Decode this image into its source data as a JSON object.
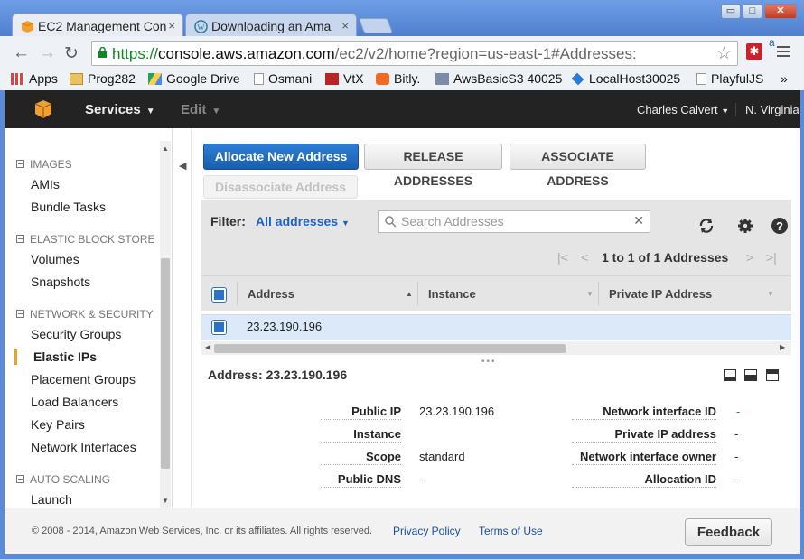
{
  "browser": {
    "tabs": [
      {
        "title": "EC2 Management Con",
        "close": "×"
      },
      {
        "title": "Downloading an Ama",
        "close": "×"
      }
    ],
    "window_buttons": {
      "minimize": "▭",
      "maximize": "□",
      "close": "✕"
    },
    "url": {
      "scheme": "https://",
      "host": "console.aws.amazon.com",
      "path": "/ec2/v2/home?region=us-east-1#Addresses:"
    },
    "bookmarks": [
      "Apps",
      "Prog282",
      "Google Drive",
      "Osmani",
      "VtX",
      "Bitly.",
      "AwsBasicS3 40025",
      "LocalHost30025",
      "PlayfulJS"
    ],
    "more": "»"
  },
  "aws": {
    "nav": {
      "services": "Services",
      "edit": "Edit"
    },
    "user": "Charles Calvert",
    "region": "N. Virginia"
  },
  "sidebar": {
    "sections": [
      {
        "title": "IMAGES",
        "items": [
          "AMIs",
          "Bundle Tasks"
        ]
      },
      {
        "title": "ELASTIC BLOCK STORE",
        "items": [
          "Volumes",
          "Snapshots"
        ]
      },
      {
        "title": "NETWORK & SECURITY",
        "items": [
          "Security Groups",
          "Elastic IPs",
          "Placement Groups",
          "Load Balancers",
          "Key Pairs",
          "Network Interfaces"
        ]
      },
      {
        "title": "AUTO SCALING",
        "items": [
          "Launch"
        ]
      }
    ],
    "active": "Elastic IPs"
  },
  "actions": {
    "allocate": "Allocate New Address",
    "release": "Release Addresses",
    "associate": "Associate Address",
    "disassociate": "Disassociate Address"
  },
  "filter": {
    "label": "Filter:",
    "value": "All addresses",
    "search_placeholder": "Search Addresses"
  },
  "pagination": {
    "text": "1 to 1 of 1 Addresses"
  },
  "table": {
    "columns": [
      "Address",
      "Instance",
      "Private IP Address"
    ],
    "rows": [
      [
        "23.23.190.196",
        "",
        ""
      ]
    ]
  },
  "detail": {
    "title": "Address: 23.23.190.196",
    "left": [
      {
        "label": "Public IP",
        "value": "23.23.190.196"
      },
      {
        "label": "Instance",
        "value": ""
      },
      {
        "label": "Scope",
        "value": "standard"
      },
      {
        "label": "Public DNS",
        "value": "-"
      }
    ],
    "right": [
      {
        "label": "Network interface ID",
        "value": "-"
      },
      {
        "label": "Private IP address",
        "value": "-"
      },
      {
        "label": "Network interface owner",
        "value": "-"
      },
      {
        "label": "Allocation ID",
        "value": "-"
      }
    ]
  },
  "footer": {
    "copyright": "© 2008 - 2014, Amazon Web Services, Inc. or its affiliates. All rights reserved.",
    "privacy": "Privacy Policy",
    "terms": "Terms of Use",
    "feedback": "Feedback"
  },
  "colors": {
    "aws_bar": "#232323",
    "primary": "#1a63c6",
    "active_nav": "#e8a32c",
    "selected_row": "#dbe9f9"
  }
}
